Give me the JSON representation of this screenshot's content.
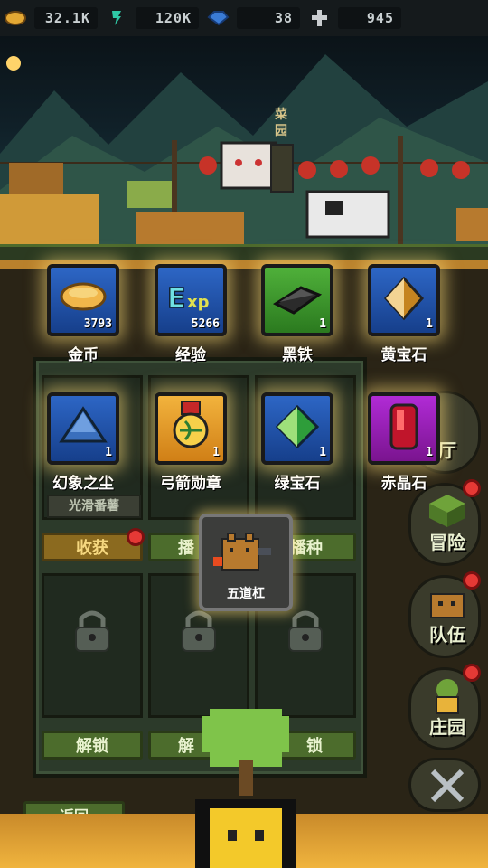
{
  "resources": {
    "gold": "32.1K",
    "exp": "120K",
    "gem": "38",
    "cross": "945"
  },
  "scene": {
    "sign": "菜园"
  },
  "rewards_row1": [
    {
      "name": "金币",
      "count": "3793",
      "color": "blue",
      "icon": "gold-coin-icon"
    },
    {
      "name": "经验",
      "count": "5266",
      "color": "blue",
      "icon": "exp-icon"
    },
    {
      "name": "黑铁",
      "count": "1",
      "color": "green",
      "icon": "black-iron-icon"
    },
    {
      "name": "黄宝石",
      "count": "1",
      "color": "blue",
      "icon": "topaz-icon"
    }
  ],
  "rewards_row2": [
    {
      "name": "幻象之尘",
      "count": "1",
      "color": "blue",
      "icon": "illusion-dust-icon"
    },
    {
      "name": "弓箭勋章",
      "count": "1",
      "color": "orange",
      "icon": "archery-medal-icon"
    },
    {
      "name": "绿宝石",
      "count": "1",
      "color": "blue",
      "icon": "emerald-icon"
    },
    {
      "name": "赤晶石",
      "count": "1",
      "color": "purple",
      "icon": "red-crystal-icon"
    }
  ],
  "plots": {
    "plot1_name": "光滑番薯",
    "harvest": "收获",
    "plant_partial": "播",
    "plant_right": "播种",
    "unlock_1": "解锁",
    "unlock_2_partial": "解",
    "unlock_3_partial": "锁",
    "back_partial": "返回"
  },
  "popup": {
    "label": "五道杠"
  },
  "side_menu": [
    {
      "label": "厅"
    },
    {
      "label": "冒险"
    },
    {
      "label": "队伍"
    },
    {
      "label": "庄园"
    }
  ],
  "colors": {
    "gold_glow": "#ffde78",
    "button_green": "#4c6c2c",
    "button_gold": "#8b6a1f",
    "notify_red": "#e53935"
  }
}
